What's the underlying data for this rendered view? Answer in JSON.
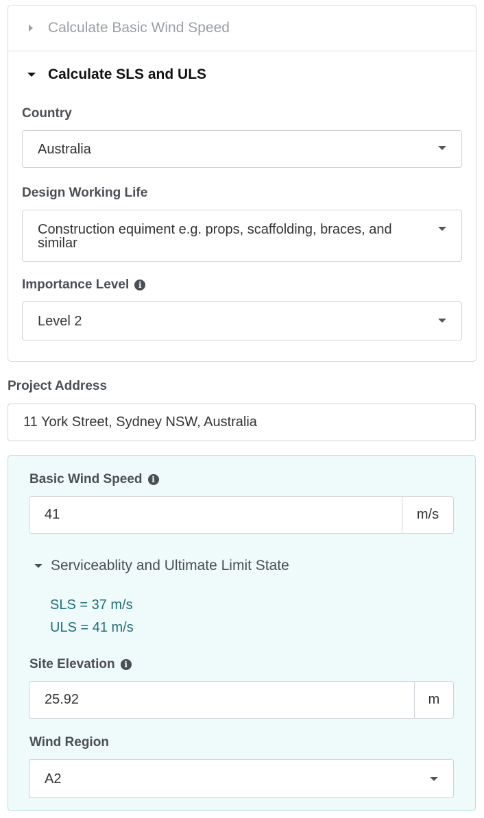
{
  "accordion": {
    "section_basic": {
      "label": "Calculate Basic Wind Speed",
      "expanded": false
    },
    "section_sls": {
      "label": "Calculate SLS and ULS",
      "expanded": true
    },
    "country": {
      "label": "Country",
      "value": "Australia"
    },
    "design_working_life": {
      "label": "Design Working Life",
      "value_line1": "Construction equiment e.g. props, scaffolding, braces, and",
      "value_line2": "similar"
    },
    "importance_level": {
      "label": "Importance Level",
      "value": "Level 2",
      "info_icon": "info-icon"
    }
  },
  "project_address": {
    "label": "Project Address",
    "value": "11 York Street, Sydney NSW, Australia"
  },
  "wind": {
    "basic_wind_speed": {
      "label": "Basic Wind Speed",
      "value": "41",
      "unit": "m/s",
      "info_icon": "info-icon"
    },
    "limit_state": {
      "toggle_label": "Serviceablity and Ultimate Limit State",
      "sls": "SLS = 37 m/s",
      "uls": "ULS = 41 m/s"
    },
    "site_elevation": {
      "label": "Site Elevation",
      "value": "25.92",
      "unit": "m",
      "info_icon": "info-icon"
    },
    "wind_region": {
      "label": "Wind Region",
      "value": "A2"
    }
  },
  "colors": {
    "panel_bg": "#effafa",
    "panel_border": "#b5dedd",
    "result_text": "#1f6f78",
    "label_text": "#4a4f55"
  }
}
